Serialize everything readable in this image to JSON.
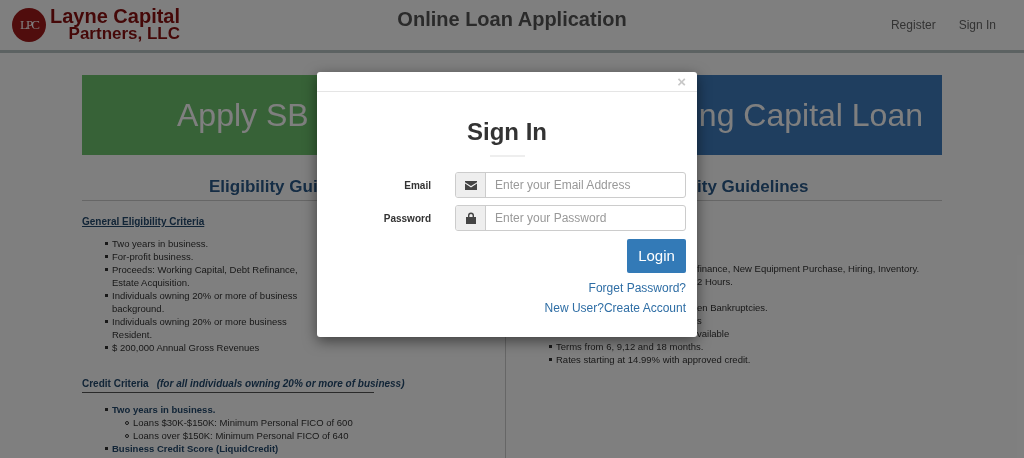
{
  "header": {
    "logo_monogram": "LPC",
    "brand_line_1": "Layne Capital",
    "brand_line_2": "Partners, LLC",
    "title": "Online Loan Application",
    "nav": [
      {
        "label": "Register"
      },
      {
        "label": "Sign In"
      }
    ]
  },
  "banners": {
    "left": "Apply SB",
    "right": "ng Capital Loan"
  },
  "left_column": {
    "heading": "Eligibility Gui",
    "section_title": "General Eligibility Criteria",
    "items": [
      {
        "lines": [
          "Two years in business."
        ]
      },
      {
        "lines": [
          "For-profit business."
        ]
      },
      {
        "lines": [
          "Proceeds: Working Capital, Debt Refinance,",
          "Estate Acquisition."
        ]
      },
      {
        "lines": [
          "Individuals owning 20% or more of business",
          "background."
        ]
      },
      {
        "lines": [
          "Individuals owning 20% or more business",
          "Resident."
        ]
      },
      {
        "lines": [
          "$ 200,000 Annual Gross Revenues"
        ]
      }
    ],
    "credit_title": "Credit Criteria",
    "credit_note": "(for all individuals owning 20% or more of business)",
    "credit_items": [
      {
        "label": "Two years in business.",
        "children": [
          "Loans $30K-$150K: Minimum Personal FICO of 600",
          "Loans over $150K: Minimum Personal FICO of 640"
        ]
      },
      {
        "label": "Business Credit Score (LiquidCredit)"
      }
    ]
  },
  "right_column": {
    "heading": "ity Guidelines",
    "items": [
      {
        "text": "finance, New Equipment Purchase, Hiring, Inventory.",
        "partial": true
      },
      {
        "text": "2 Hours.",
        "partial": true
      },
      {
        "text": "en Bankruptcies.",
        "partial": true
      },
      {
        "text": "s",
        "partial": true
      },
      {
        "text": "vailable",
        "partial": true
      },
      {
        "text": "Terms from 6, 9,12 and 18 months.",
        "partial": false
      },
      {
        "text": "Rates starting at 14.99% with approved credit.",
        "partial": false
      }
    ]
  },
  "modal": {
    "close": "×",
    "title": "Sign In",
    "fields": [
      {
        "kind": "email",
        "label": "Email",
        "placeholder": "Enter your Email Address"
      },
      {
        "kind": "password",
        "label": "Password",
        "placeholder": "Enter your Password"
      }
    ],
    "submit": "Login",
    "links": [
      "Forget Password?",
      "New User?Create Account"
    ]
  }
}
